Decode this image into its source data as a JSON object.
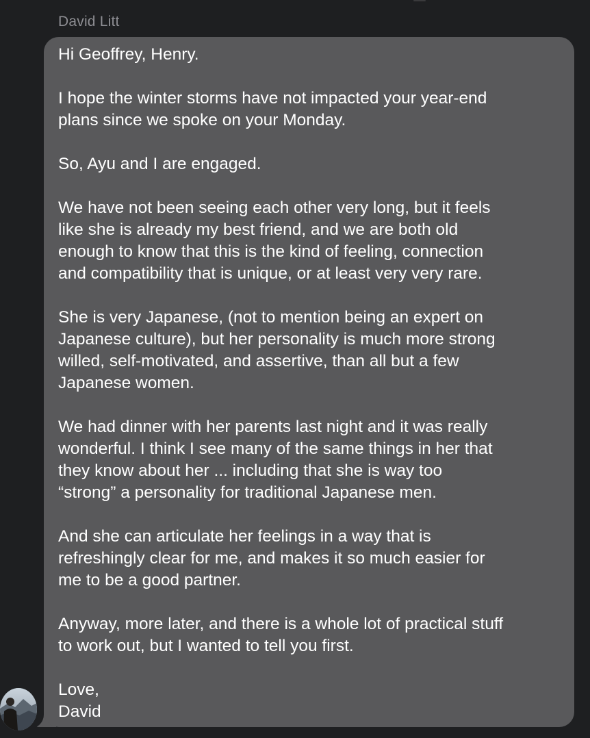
{
  "message": {
    "sender": "David Litt",
    "paragraphs": [
      "Hi Geoffrey, Henry.",
      "I hope the winter storms have not impacted your year-end\nplans since we spoke on your Monday.",
      "So, Ayu and I are engaged.",
      "We have not been seeing each other very long, but it feels\nlike she is already my best friend, and we are both old\nenough to know that this is the kind of feeling, connection\nand compatibility that is unique, or at least very very rare.",
      "She is very Japanese, (not to mention being an expert on\nJapanese culture), but her personality is much more strong\nwilled, self-motivated, and assertive, than all but a few\nJapanese women.",
      "We had dinner with her parents last night and it was really\nwonderful. I think I see many of the same things in her that\nthey know about her ... including that she is way too\n“strong” a personality for traditional Japanese men.",
      "And she can articulate her feelings in a way that is\nrefreshingly clear for me, and makes it so much easier for\nme to be a good partner.",
      "Anyway, more later, and there is a whole lot of practical stuff\nto work out, but I wanted to tell you first.",
      "Love,\nDavid"
    ]
  },
  "colors": {
    "background": "#1e1f21",
    "bubble": "#59595b",
    "text": "#ffffff",
    "sender_name": "#8e8e93"
  },
  "icons": {
    "avatar": "profile-photo-avatar"
  }
}
